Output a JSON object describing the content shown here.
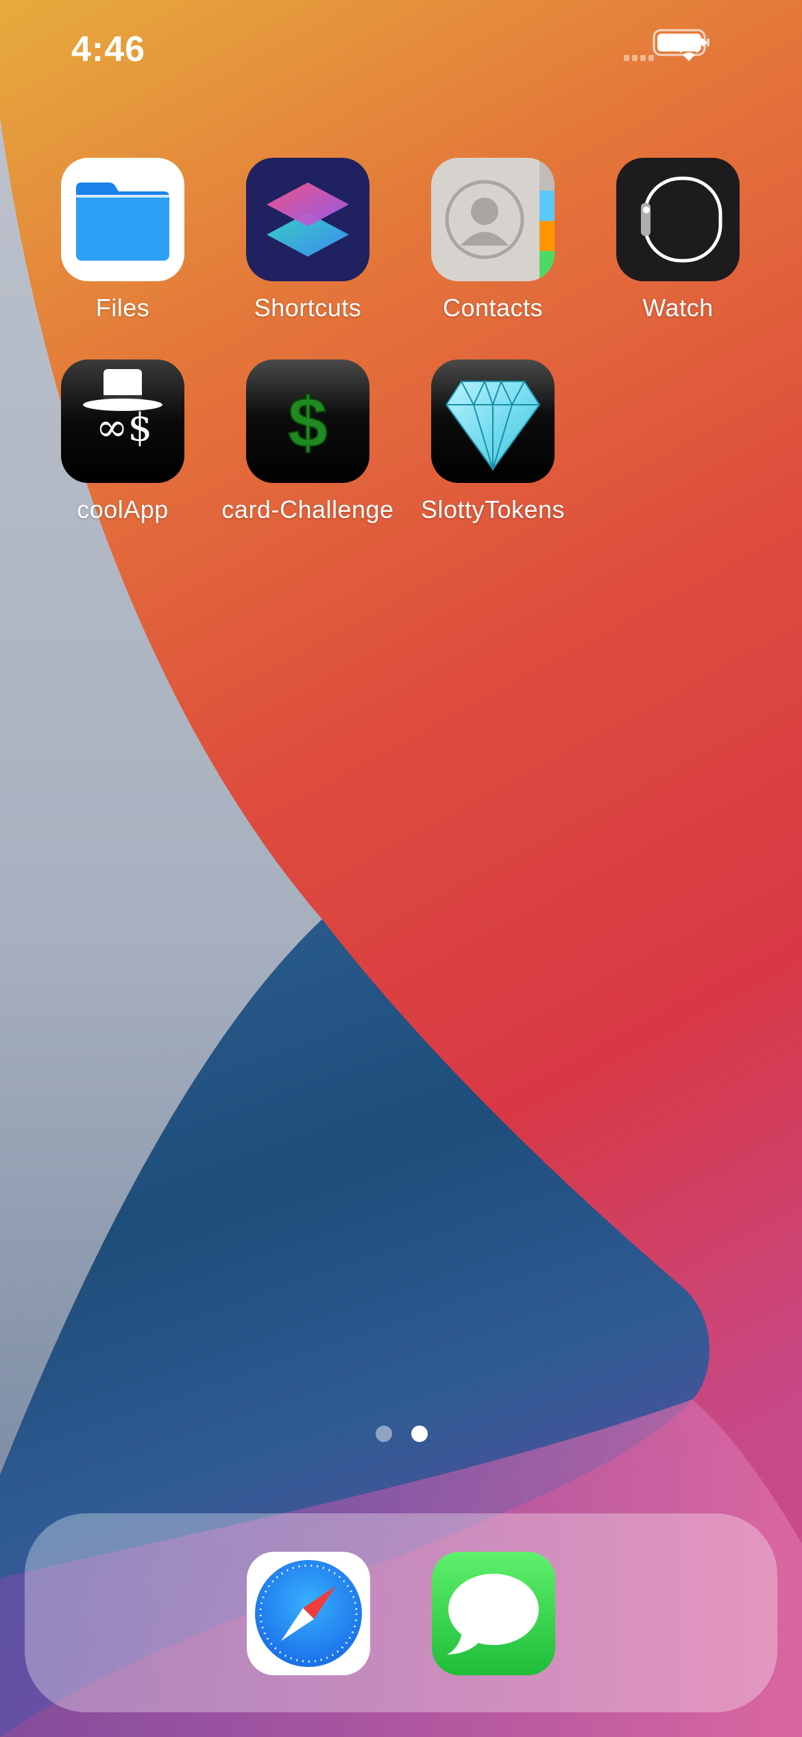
{
  "status_bar": {
    "time": "4:46",
    "icons": [
      "cellular-signal-icon",
      "wifi-icon",
      "battery-icon"
    ]
  },
  "home_screen": {
    "apps": [
      {
        "label": "Files",
        "icon": "files-folder-icon"
      },
      {
        "label": "Shortcuts",
        "icon": "shortcuts-icon"
      },
      {
        "label": "Contacts",
        "icon": "contacts-icon"
      },
      {
        "label": "Watch",
        "icon": "watch-icon"
      },
      {
        "label": "coolApp",
        "icon": "top-hat-infinity-dollar-icon"
      },
      {
        "label": "card-Challenge",
        "icon": "dollar-sign-icon"
      },
      {
        "label": "SlottyTokens",
        "icon": "diamond-icon"
      }
    ],
    "page_indicator": {
      "pages": 2,
      "current_page": 2
    }
  },
  "dock": {
    "apps": [
      {
        "icon": "safari-compass-icon"
      },
      {
        "icon": "messages-bubble-icon"
      }
    ]
  },
  "coolapp_icon_text": "∞$",
  "cardchallenge_icon_text": "$",
  "colors": {
    "wallpaper_orange": "#e59a3e",
    "wallpaper_red": "#d93845",
    "wallpaper_blue": "#1f4e7a",
    "wallpaper_gray": "#aab3c2",
    "files_blue": "#1e8cf0",
    "shortcuts_navy": "#20225e",
    "messages_green": "#34c759",
    "safari_blue": "#1f86f0"
  }
}
